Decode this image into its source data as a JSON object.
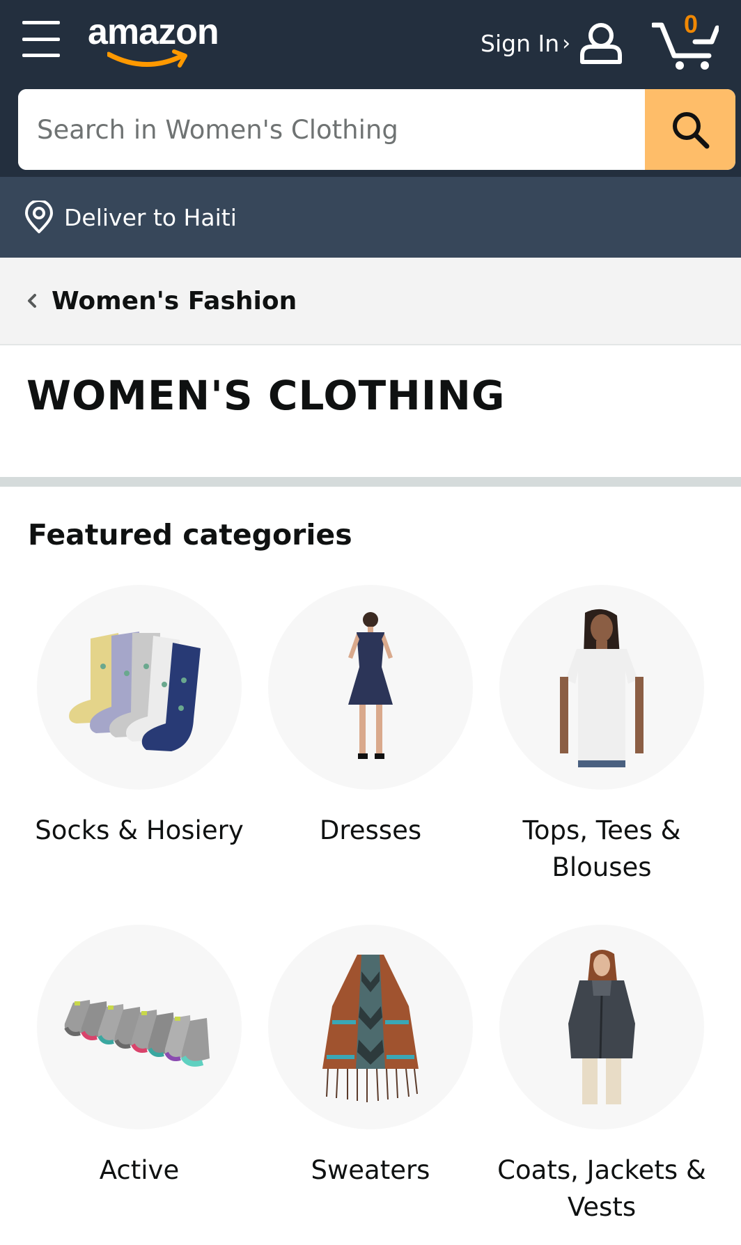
{
  "header": {
    "logo_text": "amazon",
    "signin_label": "Sign In",
    "signin_chevron": "›",
    "cart_count": "0",
    "search_placeholder": "Search in Women's Clothing"
  },
  "deliver": {
    "label": "Deliver to Haiti"
  },
  "breadcrumb": {
    "label": "Women's Fashion"
  },
  "page": {
    "title": "WOMEN'S CLOTHING"
  },
  "featured": {
    "heading": "Featured categories",
    "categories": [
      {
        "label": "Socks & Hosiery",
        "icon": "socks-image"
      },
      {
        "label": "Dresses",
        "icon": "dress-image"
      },
      {
        "label": "Tops, Tees & Blouses",
        "icon": "tshirt-model-image"
      },
      {
        "label": "Active",
        "icon": "ankle-socks-image"
      },
      {
        "label": "Sweaters",
        "icon": "poncho-sweater-image"
      },
      {
        "label": "Coats, Jackets & Vests",
        "icon": "jacket-model-image"
      }
    ]
  },
  "colors": {
    "header_bg": "#232f3e",
    "deliver_bg": "#37475a",
    "search_button": "#febd69",
    "cart_count": "#f08804",
    "logo_smile": "#ff9900"
  }
}
